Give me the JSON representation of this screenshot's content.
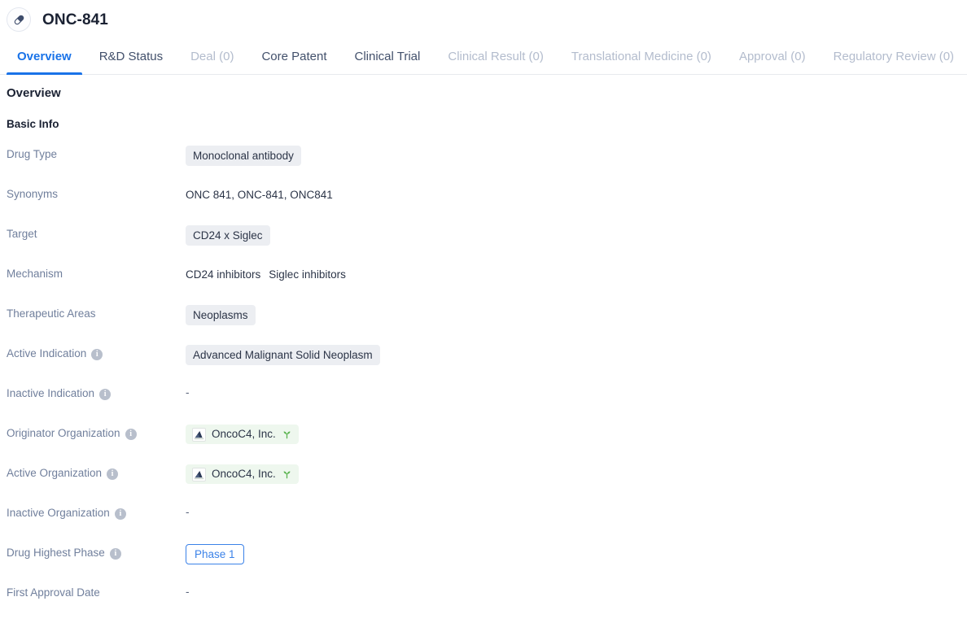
{
  "header": {
    "icon": "pill-capsule-icon",
    "title": "ONC-841"
  },
  "tabs": [
    {
      "label": "Overview",
      "state": "active"
    },
    {
      "label": "R&D Status",
      "state": "normal"
    },
    {
      "label": "Deal (0)",
      "state": "muted"
    },
    {
      "label": "Core Patent",
      "state": "normal"
    },
    {
      "label": "Clinical Trial",
      "state": "normal"
    },
    {
      "label": "Clinical Result (0)",
      "state": "muted"
    },
    {
      "label": "Translational Medicine (0)",
      "state": "muted"
    },
    {
      "label": "Approval (0)",
      "state": "muted"
    },
    {
      "label": "Regulatory Review (0)",
      "state": "muted"
    }
  ],
  "overview": {
    "section_title": "Overview",
    "subsection_title": "Basic Info",
    "fields": [
      {
        "label": "Drug Type",
        "has_info": false,
        "type": "tags",
        "values": [
          "Monoclonal antibody"
        ]
      },
      {
        "label": "Synonyms",
        "has_info": false,
        "type": "text",
        "values": [
          "ONC 841,  ONC-841,  ONC841"
        ]
      },
      {
        "label": "Target",
        "has_info": false,
        "type": "tags",
        "values": [
          "CD24 x Siglec"
        ]
      },
      {
        "label": "Mechanism",
        "has_info": false,
        "type": "text-list",
        "values": [
          "CD24 inhibitors",
          "Siglec inhibitors"
        ]
      },
      {
        "label": "Therapeutic Areas",
        "has_info": false,
        "type": "tags",
        "values": [
          "Neoplasms"
        ]
      },
      {
        "label": "Active Indication",
        "has_info": true,
        "type": "tags",
        "values": [
          "Advanced Malignant Solid Neoplasm"
        ]
      },
      {
        "label": "Inactive Indication",
        "has_info": true,
        "type": "empty",
        "values": [
          "-"
        ]
      },
      {
        "label": "Originator Organization",
        "has_info": true,
        "type": "orgs",
        "values": [
          "OncoC4, Inc."
        ]
      },
      {
        "label": "Active Organization",
        "has_info": true,
        "type": "orgs",
        "values": [
          "OncoC4, Inc."
        ]
      },
      {
        "label": "Inactive Organization",
        "has_info": true,
        "type": "empty",
        "values": [
          "-"
        ]
      },
      {
        "label": "Drug Highest Phase",
        "has_info": true,
        "type": "phase",
        "values": [
          "Phase 1"
        ]
      },
      {
        "label": "First Approval Date",
        "has_info": false,
        "type": "empty",
        "values": [
          "-"
        ]
      }
    ]
  },
  "icons": {
    "info": "i",
    "org_logo": "oncoc4-logo-icon",
    "sprout": "sprout-icon"
  },
  "colors": {
    "accent": "#1a73e8",
    "tag_bg": "#eceef2",
    "org_tag_bg": "#eef7ee",
    "sprout_green": "#5bb450",
    "phase_border": "#3b82e8",
    "label_text": "#707f9c",
    "muted_tab": "#b3bccd"
  }
}
